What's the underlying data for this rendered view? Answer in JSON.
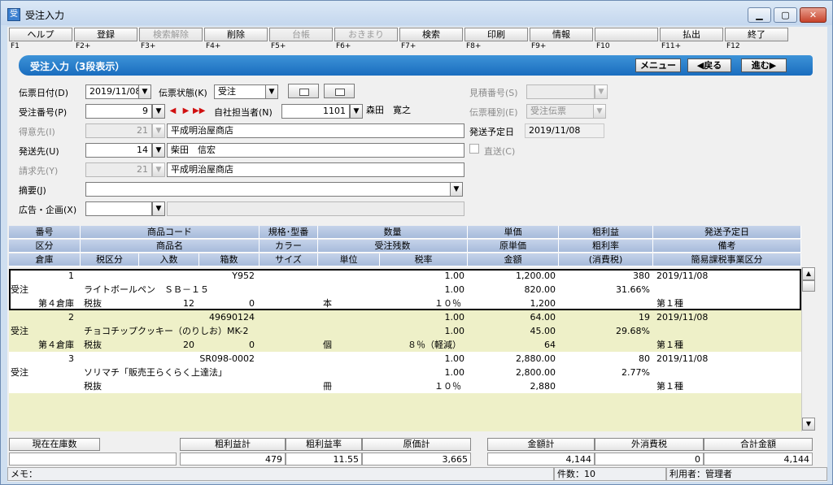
{
  "window": {
    "title": "受注入力",
    "icon": "app-icon",
    "min": "▁",
    "max": "▢",
    "close": "✕"
  },
  "fkeys": [
    {
      "label": "ヘルプ",
      "key": "F1",
      "enabled": true
    },
    {
      "label": "登録",
      "key": "F2+",
      "enabled": true
    },
    {
      "label": "検索解除",
      "key": "F3+",
      "enabled": false
    },
    {
      "label": "削除",
      "key": "F4+",
      "enabled": true
    },
    {
      "label": "台帳",
      "key": "F5+",
      "enabled": false
    },
    {
      "label": "おきまり",
      "key": "F6+",
      "enabled": false
    },
    {
      "label": "検索",
      "key": "F7+",
      "enabled": true
    },
    {
      "label": "印刷",
      "key": "F8+",
      "enabled": true
    },
    {
      "label": "情報",
      "key": "F9+",
      "enabled": true
    },
    {
      "label": "",
      "key": "F10",
      "enabled": true
    },
    {
      "label": "払出",
      "key": "F11+",
      "enabled": true
    },
    {
      "label": "終了",
      "key": "F12",
      "enabled": true
    }
  ],
  "header": {
    "title": "受注入力（3段表示）",
    "menu": "メニュー",
    "back": "◀戻る",
    "next": "進む▶"
  },
  "form": {
    "slip_date_label": "伝票日付(D)",
    "slip_date": "2019/11/08",
    "slip_status_label": "伝票状態(K)",
    "slip_status": "受注",
    "order_no_label": "受注番号(P)",
    "order_no": "9",
    "staff_label": "自社担当者(N)",
    "staff_code": "1101",
    "staff_name": "森田　寛之",
    "customer_label": "得意先(I)",
    "customer_code": "21",
    "customer_name": "平成明治屋商店",
    "ship_label": "発送先(U)",
    "ship_code": "14",
    "ship_name": "柴田　信宏",
    "bill_label": "請求先(Y)",
    "bill_code": "21",
    "bill_name": "平成明治屋商店",
    "memo_label": "摘要(J)",
    "memo": "",
    "ad_label": "広告・企画(X)",
    "ad": "",
    "quote_label": "見積番号(S)",
    "quote": "",
    "slip_kind_label": "伝票種別(E)",
    "slip_kind": "受注伝票",
    "ship_date_label": "発送予定日",
    "ship_date": "2019/11/08",
    "direct_label": "直送(C)"
  },
  "grid_head": {
    "r1": [
      "番号",
      "商品コード",
      "規格･型番",
      "数量",
      "単価",
      "粗利益",
      "発送予定日"
    ],
    "r2": [
      "区分",
      "商品名",
      "カラー",
      "受注残数",
      "原単価",
      "粗利率",
      "備考"
    ],
    "r3": [
      "倉庫",
      "税区分",
      "入数",
      "箱数",
      "サイズ",
      "単位",
      "税率",
      "金額",
      "(消費税)",
      "簡易課税事業区分"
    ]
  },
  "rows": [
    {
      "no": "1",
      "code": "Y952",
      "qty": "1.00",
      "price": "1,200.00",
      "profit": "380",
      "date": "2019/11/08",
      "kubun": "受注",
      "name": "ライトボールペン　ＳＢ－１５",
      "remain": "1.00",
      "cost": "820.00",
      "rate": "31.66%",
      "wh": "第４倉庫",
      "tax": "税抜",
      "irisu": "12",
      "box": "0",
      "unit": "本",
      "taxrate": "１０％",
      "amount": "1,200",
      "biz": "第１種",
      "bg": "#ffffff"
    },
    {
      "no": "2",
      "code": "49690124",
      "qty": "1.00",
      "price": "64.00",
      "profit": "19",
      "date": "2019/11/08",
      "kubun": "受注",
      "name": "チョコチップクッキー（のりしお）MK-2",
      "remain": "1.00",
      "cost": "45.00",
      "rate": "29.68%",
      "wh": "第４倉庫",
      "tax": "税抜",
      "irisu": "20",
      "box": "0",
      "unit": "個",
      "taxrate": "８％（軽減）",
      "amount": "64",
      "biz": "第１種",
      "bg": "#eef0c8"
    },
    {
      "no": "3",
      "code": "SR098-0002",
      "qty": "1.00",
      "price": "2,880.00",
      "profit": "80",
      "date": "2019/11/08",
      "kubun": "受注",
      "name": "ソリマチ「販売王らくらく上達法」",
      "remain": "1.00",
      "cost": "2,800.00",
      "rate": "2.77%",
      "wh": "",
      "tax": "税抜",
      "irisu": "",
      "box": "",
      "unit": "冊",
      "taxrate": "１０％",
      "amount": "2,880",
      "biz": "第１種",
      "bg": "#ffffff"
    }
  ],
  "totals": {
    "stock_label": "現在在庫数",
    "stock": "",
    "gp_label": "粗利益計",
    "gp": "479",
    "gpr_label": "粗利益率",
    "gpr": "11.55",
    "cost_label": "原価計",
    "cost": "3,665",
    "amt_label": "金額計",
    "amt": "4,144",
    "tax_label": "外消費税",
    "tax": "0",
    "total_label": "合計金額",
    "total": "4,144"
  },
  "status": {
    "memo": "メモ：",
    "count": "件数：10",
    "user": "利用者：管理者"
  }
}
